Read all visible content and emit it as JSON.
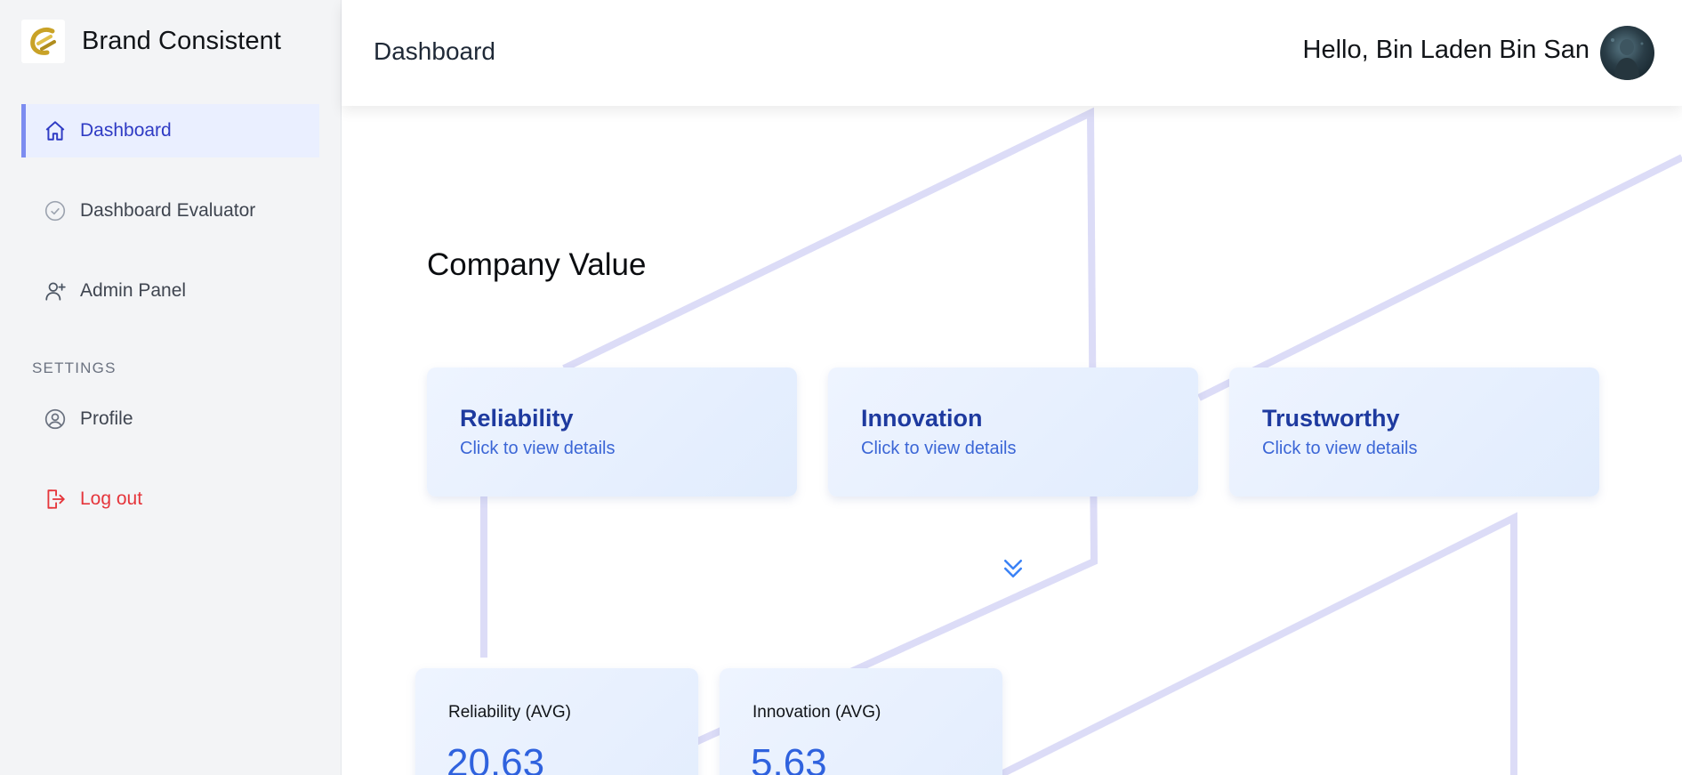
{
  "brand": {
    "name": "Brand Consistent",
    "logo_icon": "brand-e-logo",
    "accent": "#c9a227"
  },
  "sidebar": {
    "items": [
      {
        "label": "Dashboard",
        "icon": "home-icon",
        "active": true
      },
      {
        "label": "Dashboard Evaluator",
        "icon": "check-circle-icon",
        "active": false
      },
      {
        "label": "Admin Panel",
        "icon": "user-plus-icon",
        "active": false
      }
    ],
    "settings_label": "SETTINGS",
    "settings_items": [
      {
        "label": "Profile",
        "icon": "user-circle-icon"
      },
      {
        "label": "Log out",
        "icon": "logout-icon"
      }
    ]
  },
  "header": {
    "title": "Dashboard",
    "greeting": "Hello, Bin Laden Bin San"
  },
  "main": {
    "title": "Company Value",
    "value_cards": [
      {
        "title": "Reliability",
        "subtitle": "Click to view details"
      },
      {
        "title": "Innovation",
        "subtitle": "Click to view details"
      },
      {
        "title": "Trustworthy",
        "subtitle": "Click to view details"
      }
    ],
    "expand_icon": "double-chevron-down-icon",
    "avg_cards": [
      {
        "label": "Reliability (AVG)",
        "value": "20.63"
      },
      {
        "label": "Innovation (AVG)",
        "value": "5.63"
      }
    ]
  },
  "colors": {
    "active_nav_bg": "#eaefff",
    "active_nav_text": "#2f3bc4",
    "logout": "#e5353b",
    "card_title": "#1e3a9f",
    "card_link": "#3b66d6",
    "bg_lines": "#dcdcf7"
  }
}
